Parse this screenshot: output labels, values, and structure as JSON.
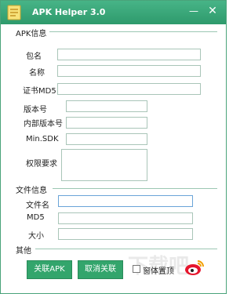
{
  "window": {
    "title": "APK Helper 3.0",
    "minimize": "—",
    "close": "✕"
  },
  "apk_group": {
    "title": "APK信息",
    "package_label": "包名",
    "name_label": "名称",
    "cert_label": "证书MD5",
    "version_label": "版本号",
    "internal_version_label": "内部版本号",
    "minsdk_label": "Min.SDK",
    "permissions_label": "权限要求"
  },
  "file_group": {
    "title": "文件信息",
    "filename_label": "文件名",
    "md5_label": "MD5",
    "size_label": "大小"
  },
  "other_group": {
    "title": "其他",
    "associate_button": "关联APK",
    "disassociate_button": "取消关联",
    "topmost_label": "窗体置顶",
    "topmost_checked": "false"
  },
  "watermark": "下载吧",
  "icons": {
    "app": "apk-file-icon",
    "weibo": "weibo-icon"
  },
  "colors": {
    "titlebar": "#3aa87a",
    "button": "#33a56c"
  }
}
